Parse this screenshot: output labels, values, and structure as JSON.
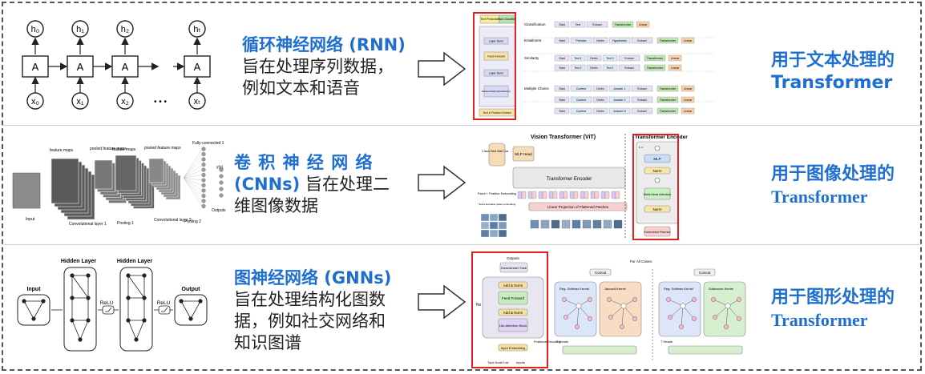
{
  "rows": [
    {
      "title": "循环神经网络 (RNN)",
      "lines": [
        "旨在处理序列数据，",
        "例如文本和语音"
      ],
      "right_cn": "用于文本处理的",
      "right_en": "Transformer"
    },
    {
      "title_line1": "卷 积 神 经 网 络",
      "title_line2_hl": "(CNNs)",
      "title_line2_rest": " 旨在处理二",
      "line3": "维图像数据",
      "right_cn": "用于图像处理的",
      "right_en": "Transformer"
    },
    {
      "title": "图神经网络 (GNNs)",
      "lines": [
        "旨在处理结构化图数",
        "据，例如社交网络和",
        "知识图谱"
      ],
      "right_cn": "用于图形处理的",
      "right_en": "Transformer"
    }
  ],
  "rnn": {
    "hidden": [
      "h₀",
      "h₁",
      "h₂",
      "hₜ"
    ],
    "cell": "A",
    "inputs": [
      "x₀",
      "x₁",
      "x₂",
      "xₜ"
    ],
    "dots": "• • •"
  },
  "cnn": {
    "labels": [
      "feature maps",
      "pooled feature maps",
      "feature maps",
      "pooled feature maps",
      "Fully-connected 1",
      "Input",
      "Convolutional layer 1",
      "Pooling 1",
      "Convolutional layer 2",
      "Pooling 2",
      "Outputs",
      "y(x)"
    ]
  },
  "gnn": {
    "labels": [
      "Hidden Layer",
      "Hidden Layer",
      "Input",
      "ReLU",
      "ReLU",
      "Output"
    ]
  },
  "nlp_transformer": {
    "blocks": [
      "Text Prediction",
      "Task Classifier",
      "Layer Norm",
      "Feed Forward",
      "Layer Norm",
      "Masked Multi Self Attention",
      "Text & Position Embed"
    ],
    "tasks": [
      "Classification",
      "Entailment",
      "Similarity",
      "Multiple Choice"
    ],
    "tokens": [
      "Start",
      "Text",
      "Extract",
      "Premise",
      "Delim",
      "Hypothesis",
      "Text 1",
      "Text 2",
      "Context",
      "Answer 1",
      "Answer 2",
      "Answer N"
    ],
    "transformer": "Transformer",
    "linear": "Linear"
  },
  "vit": {
    "title": "Vision Transformer (ViT)",
    "encoder_title": "Transformer Encoder",
    "class_label": "Class Bird Ball Car ...",
    "mlp_head": "MLP Head",
    "encoder": "Transformer Encoder",
    "patch_label": "Patch + Position Embedding",
    "extra_label": "* Extra learnable [class] embedding",
    "linear_proj": "Linear Projection of Flattened Patches",
    "mlp": "MLP",
    "norm": "Norm",
    "mha": "Multi-Head Attention",
    "embedded": "Embedded Patches",
    "lx": "L x"
  },
  "graph_transformer": {
    "outputs": "Outputs",
    "downstream": "Downstream Task",
    "add_norm": "Add & Norm",
    "feed_forward": "Feed Forward",
    "attention": "Lite-Attention Block",
    "input_embedding": "Input Embedding",
    "nx": "Nx",
    "positional": "Positional Encoding",
    "topk": "Topk Node List",
    "inputs": "Inputs",
    "all_cases": "For All Cases:",
    "concat": "Concat",
    "reg_softmax": "Reg. Softmax Kernel",
    "jaccard": "Jaccard Kernel",
    "subtractor": "Subtractor Kernel",
    "heads": "T Heads"
  },
  "colors": {
    "accent": "#1f6fd1",
    "red": "#e02020",
    "dash": "#555555"
  }
}
